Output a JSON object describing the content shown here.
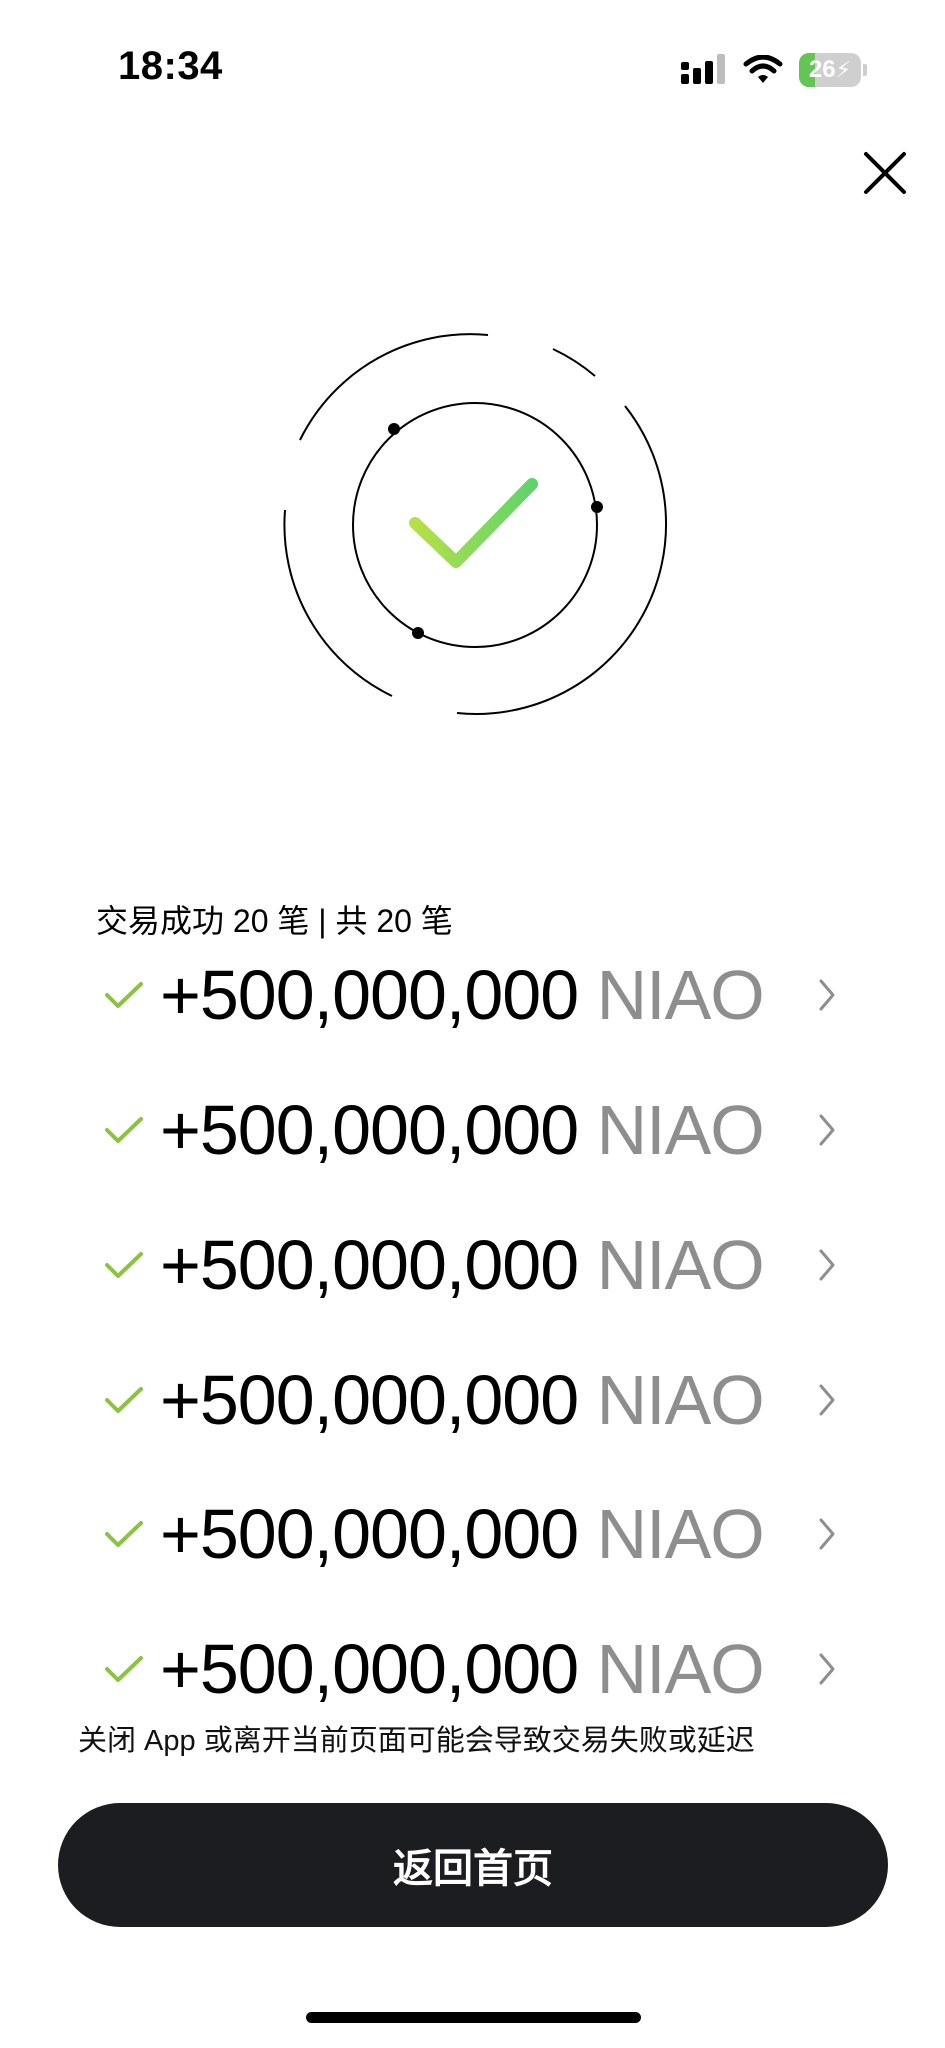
{
  "status_bar": {
    "time": "18:34",
    "battery_level": "26"
  },
  "summary": "交易成功 20 笔 | 共 20 笔",
  "transactions": [
    {
      "amount": "+500,000,000",
      "unit": "NIAO"
    },
    {
      "amount": "+500,000,000",
      "unit": "NIAO"
    },
    {
      "amount": "+500,000,000",
      "unit": "NIAO"
    },
    {
      "amount": "+500,000,000",
      "unit": "NIAO"
    },
    {
      "amount": "+500,000,000",
      "unit": "NIAO"
    },
    {
      "amount": "+500,000,000",
      "unit": "NIAO"
    }
  ],
  "warning": "关闭 App 或离开当前页面可能会导致交易失败或延迟",
  "home_button_label": "返回首页",
  "colors": {
    "success_green": "#8ac43f",
    "button_dark": "#1c1d20",
    "unit_gray": "#8e8e8e",
    "battery_green": "#62c554"
  },
  "icons": [
    "signal-icon",
    "wifi-icon",
    "battery-icon",
    "close-icon",
    "success-check-icon",
    "check-icon",
    "chevron-right-icon"
  ]
}
